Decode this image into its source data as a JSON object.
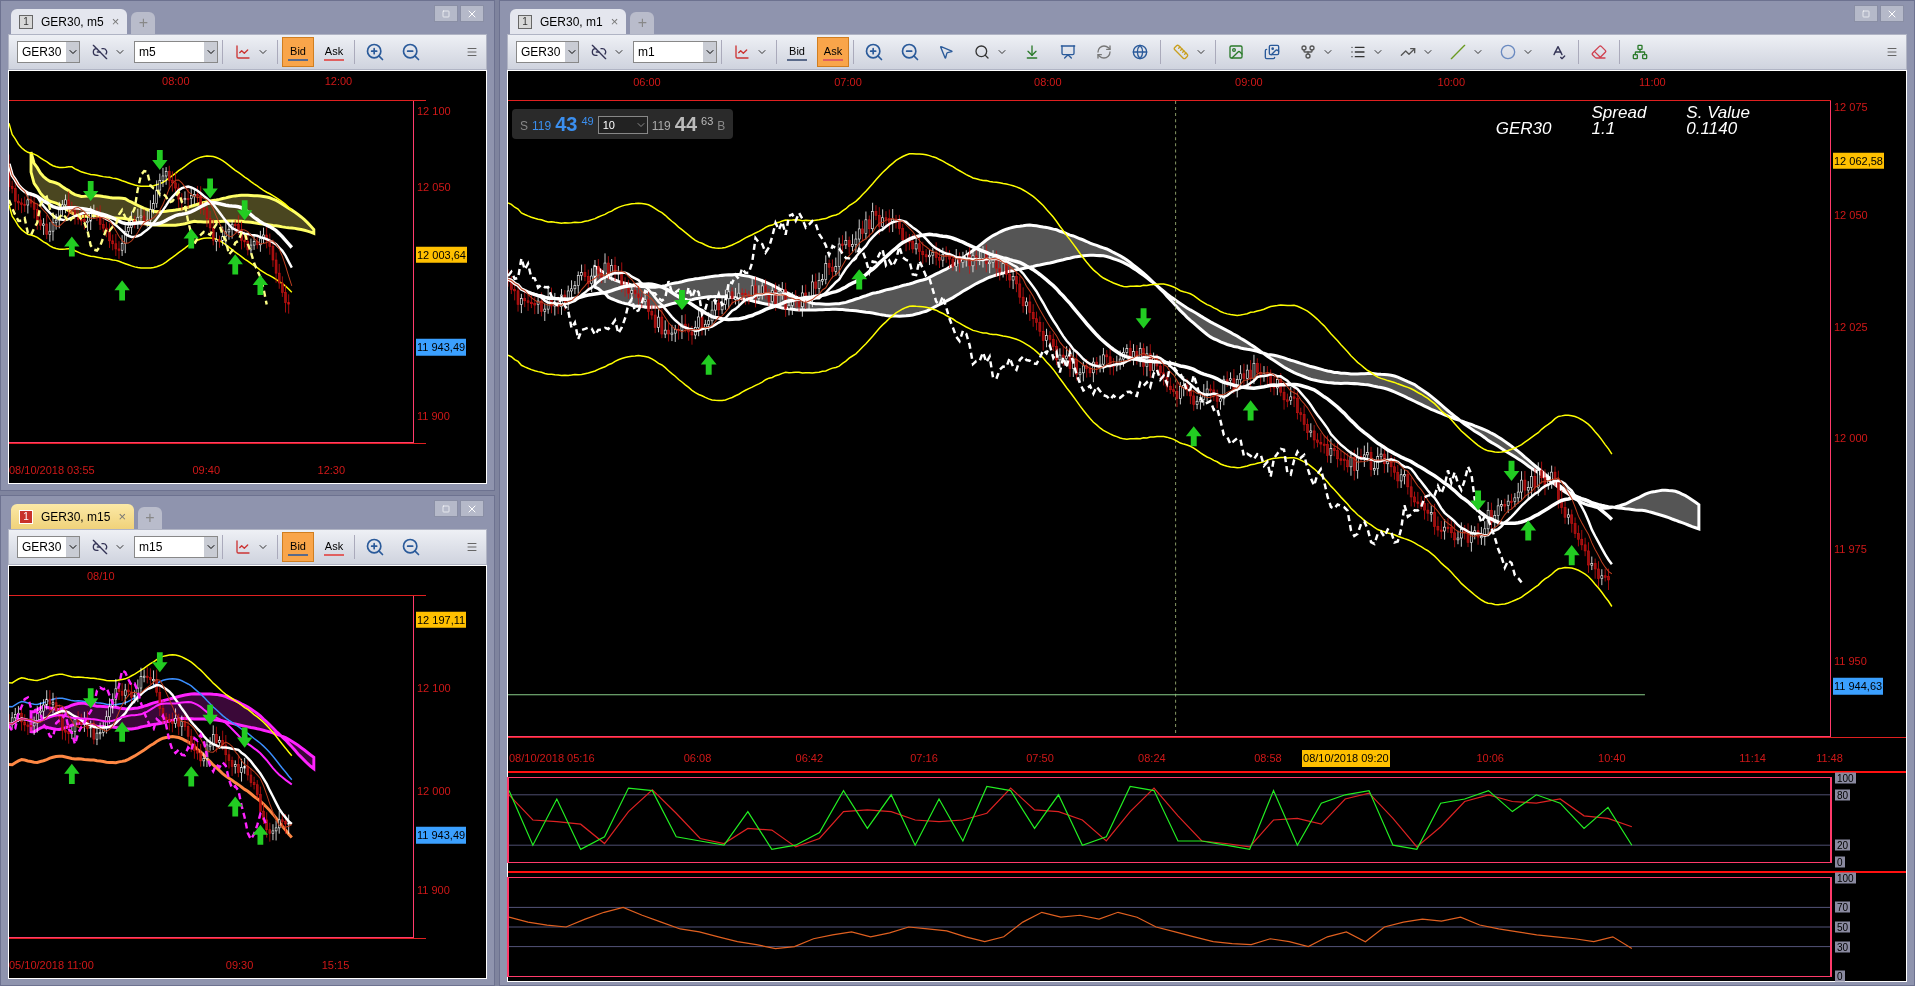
{
  "windows": [
    {
      "tab": {
        "number": "1",
        "title": "GER30, m5",
        "close": "×",
        "active": false
      },
      "new_tab": "+",
      "toolbar": {
        "symbol": "GER30",
        "timeframe": "m5",
        "price_modes": [
          {
            "label": "Bid",
            "selected": true
          },
          {
            "label": "Ask",
            "selected": false
          }
        ]
      },
      "time_axis_top": [
        "08:00",
        "12:00"
      ],
      "price_axis": [
        {
          "label": "12 100"
        },
        {
          "label": "12 050"
        },
        {
          "label": "12 003,64",
          "color": "#ffc000"
        },
        {
          "label": "11 943,49",
          "color": "#3ba0ff"
        },
        {
          "label": "11 900"
        }
      ],
      "time_axis_bottom": [
        "08/10/2018 03:55",
        "09:40",
        "12:30"
      ]
    },
    {
      "tab": {
        "number": "1",
        "title": "GER30, m15",
        "close": "×",
        "active": true
      },
      "new_tab": "+",
      "toolbar": {
        "symbol": "GER30",
        "timeframe": "m15",
        "price_modes": [
          {
            "label": "Bid",
            "selected": true
          },
          {
            "label": "Ask",
            "selected": false
          }
        ]
      },
      "time_axis_top": [
        "08/10"
      ],
      "price_axis": [
        {
          "label": "12 197,11",
          "color": "#ffc000"
        },
        {
          "label": "12 100"
        },
        {
          "label": "12 000"
        },
        {
          "label": "11 943,49",
          "color": "#3ba0ff"
        },
        {
          "label": "11 900"
        }
      ],
      "time_axis_bottom": [
        "05/10/2018 11:00",
        "09:30",
        "15:15"
      ]
    }
  ],
  "main": {
    "tab": {
      "number": "1",
      "title": "GER30, m1",
      "close": "×",
      "active": false
    },
    "new_tab": "+",
    "toolbar": {
      "symbol": "GER30",
      "timeframe": "m1",
      "price_modes": [
        {
          "label": "Bid",
          "selected": false
        },
        {
          "label": "Ask",
          "selected": true
        }
      ]
    },
    "quote": {
      "sell_label": "S",
      "sell_prefix": "119",
      "sell_big": "43",
      "sell_small": "49",
      "amount": "10",
      "buy_prefix": "119",
      "buy_big": "44",
      "buy_small": "63",
      "buy_label": "B"
    },
    "info": {
      "symbol": "GER30",
      "spread_label": "Spread",
      "spread": "1.1",
      "value_label": "S. Value",
      "value": "0.1140"
    },
    "time_axis_top": [
      "06:00",
      "07:00",
      "08:00",
      "09:00",
      "10:00",
      "11:00"
    ],
    "price_axis": [
      {
        "label": "12 075"
      },
      {
        "label": "12 062,58",
        "color": "#ffc000"
      },
      {
        "label": "12 050"
      },
      {
        "label": "12 025"
      },
      {
        "label": "12 000"
      },
      {
        "label": "11 975"
      },
      {
        "label": "11 950"
      },
      {
        "label": "11 944,63",
        "color": "#3ba0ff"
      }
    ],
    "time_axis_bottom": [
      {
        "label": "08/10/2018 05:16"
      },
      {
        "label": "06:08"
      },
      {
        "label": "06:42"
      },
      {
        "label": "07:16"
      },
      {
        "label": "07:50"
      },
      {
        "label": "08:24"
      },
      {
        "label": "08:58"
      },
      {
        "label": "08/10/2018 09:20",
        "color": "#ffc000"
      },
      {
        "label": "10:06"
      },
      {
        "label": "10:40"
      },
      {
        "label": "11:14"
      },
      {
        "label": "11:48"
      }
    ],
    "stochastic": {
      "chart_data": {
        "type": "line",
        "grid": true,
        "ylim": [
          0,
          100
        ],
        "yticks": [
          {
            "value": 100,
            "label": "100"
          },
          {
            "value": 80,
            "label": "80"
          },
          {
            "value": 20,
            "label": "20"
          },
          {
            "value": 0,
            "label": "0"
          }
        ],
        "series": [
          {
            "color": "#22ee22",
            "values": [
              85,
              20,
              75,
              15,
              30,
              88,
              85,
              30,
              25,
              20,
              60,
              15,
              20,
              35,
              85,
              40,
              80,
              20,
              75,
              25,
              90,
              85,
              40,
              80,
              20,
              30,
              90,
              85,
              25,
              25,
              20,
              15,
              85,
              20,
              70,
              80,
              85,
              20,
              15,
              70,
              75,
              85,
              60,
              80,
              70,
              40,
              65,
              20
            ]
          },
          {
            "color": "#dd2222",
            "values": [
              80,
              50,
              48,
              45,
              22,
              60,
              86,
              58,
              28,
              22,
              40,
              38,
              18,
              28,
              60,
              62,
              60,
              50,
              48,
              50,
              58,
              88,
              62,
              60,
              50,
              25,
              60,
              88,
              55,
              25,
              22,
              18,
              50,
              52,
              45,
              75,
              82,
              52,
              18,
              42,
              72,
              80,
              72,
              70,
              75,
              55,
              52,
              42
            ]
          }
        ]
      }
    },
    "rsi": {
      "chart_data": {
        "type": "line",
        "grid": true,
        "ylim": [
          0,
          100
        ],
        "yticks": [
          {
            "value": 100,
            "label": "100"
          },
          {
            "value": 70,
            "label": "70"
          },
          {
            "value": 50,
            "label": "50"
          },
          {
            "value": 30,
            "label": "30"
          },
          {
            "value": 0,
            "label": "0"
          }
        ],
        "series": [
          {
            "color": "#e06020",
            "values": [
              60,
              55,
              52,
              50,
              58,
              65,
              70,
              62,
              55,
              48,
              45,
              40,
              35,
              32,
              28,
              30,
              38,
              42,
              45,
              40,
              44,
              50,
              48,
              46,
              40,
              35,
              40,
              55,
              65,
              60,
              62,
              58,
              65,
              60,
              50,
              45,
              40,
              35,
              33,
              32,
              38,
              35,
              30,
              40,
              45,
              35,
              50,
              55,
              58,
              56,
              60,
              52,
              48,
              45,
              42,
              40,
              38,
              35,
              40,
              28
            ]
          }
        ]
      }
    }
  }
}
